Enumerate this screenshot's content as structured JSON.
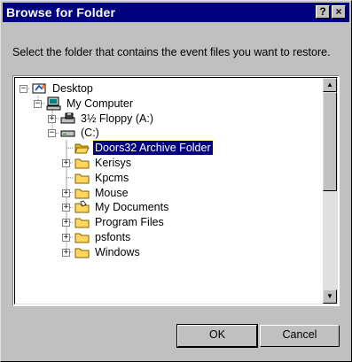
{
  "dialog": {
    "title": "Browse for Folder",
    "help_label": "?",
    "close_label": "×",
    "prompt": "Select the folder that contains the event files you want to restore."
  },
  "tree": {
    "nodes": [
      {
        "label": "Desktop",
        "icon": "desktop-icon",
        "expander": "minus"
      },
      {
        "label": "My Computer",
        "icon": "computer-icon",
        "expander": "minus"
      },
      {
        "label": "3½ Floppy (A:)",
        "icon": "floppy-drive-icon",
        "expander": "plus"
      },
      {
        "label": "(C:)",
        "icon": "hard-drive-icon",
        "expander": "minus"
      },
      {
        "label": "Doors32 Archive Folder",
        "icon": "open-folder-icon",
        "expander": "none",
        "selected": true
      },
      {
        "label": "Kerisys",
        "icon": "folder-icon",
        "expander": "plus"
      },
      {
        "label": "Kpcms",
        "icon": "folder-icon",
        "expander": "none"
      },
      {
        "label": "Mouse",
        "icon": "folder-icon",
        "expander": "plus"
      },
      {
        "label": "My Documents",
        "icon": "documents-folder-icon",
        "expander": "plus"
      },
      {
        "label": "Program Files",
        "icon": "folder-icon",
        "expander": "plus"
      },
      {
        "label": "psfonts",
        "icon": "folder-icon",
        "expander": "plus"
      },
      {
        "label": "Windows",
        "icon": "folder-icon",
        "expander": "plus"
      }
    ]
  },
  "scrollbar": {
    "up_arrow": "▲",
    "down_arrow": "▼",
    "position_fraction": 0.0,
    "visible_fraction": 0.5
  },
  "buttons": {
    "ok": "OK",
    "cancel": "Cancel"
  },
  "colors": {
    "titlebar": "#000080",
    "selection": "#000080",
    "face": "#c0c0c0",
    "folder": "#ffd75e"
  }
}
